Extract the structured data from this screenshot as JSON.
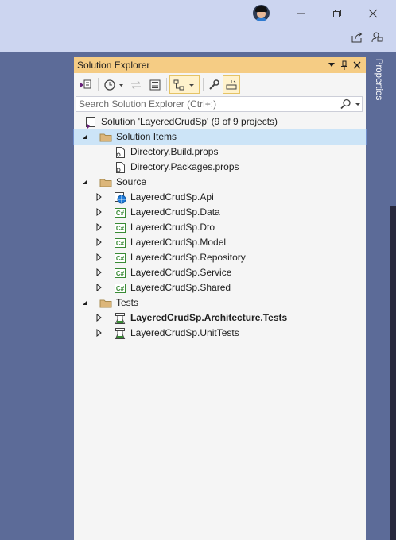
{
  "window": {
    "user_avatar": "user-avatar",
    "minimize_icon": "minimize-icon",
    "restore_icon": "restore-icon",
    "close_icon": "close-icon",
    "share_icon": "share-icon",
    "feedback_icon": "feedback-icon"
  },
  "panel": {
    "title": "Solution Explorer",
    "header_icons": [
      "dropdown-icon",
      "pin-icon",
      "close-icon"
    ]
  },
  "side_tab": {
    "label": "Properties"
  },
  "toolbar": {
    "icons": [
      "switch-views-icon",
      "history-icon",
      "sync-icon",
      "collapse-all-icon",
      "show-all-files-icon",
      "properties-wrench-icon",
      "preview-icon"
    ]
  },
  "search": {
    "placeholder": "Search Solution Explorer (Ctrl+;)"
  },
  "tree": {
    "solution": "Solution 'LayeredCrudSp' (9 of 9 projects)",
    "solution_items": "Solution Items",
    "directory_build": "Directory.Build.props",
    "directory_packages": "Directory.Packages.props",
    "source": "Source",
    "api": "LayeredCrudSp.Api",
    "data": "LayeredCrudSp.Data",
    "dto": "LayeredCrudSp.Dto",
    "model": "LayeredCrudSp.Model",
    "repository": "LayeredCrudSp.Repository",
    "service": "LayeredCrudSp.Service",
    "shared": "LayeredCrudSp.Shared",
    "tests": "Tests",
    "arch_tests": "LayeredCrudSp.Architecture.Tests",
    "unit_tests": "LayeredCrudSp.UnitTests"
  },
  "colors": {
    "titlebar": "#ccd5f0",
    "background": "#5c6b98",
    "panel_header": "#f5cc84",
    "selection": "#cce4f7",
    "csharp_green": "#388a34",
    "folder": "#dcb67a"
  }
}
